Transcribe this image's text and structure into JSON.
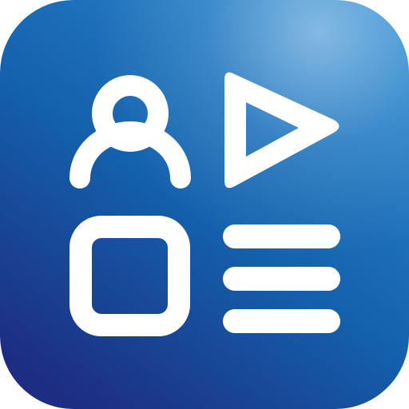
{
  "app_icon": {
    "background": {
      "gradient_top": "#2c8ad0",
      "gradient_mid": "#1460ac",
      "gradient_bottom": "#1d2d82",
      "haze": "#cfe6f7"
    },
    "glyph_color": "#ffffff",
    "glyphs": [
      "user-icon",
      "play-icon",
      "square-icon",
      "list-icon"
    ]
  }
}
